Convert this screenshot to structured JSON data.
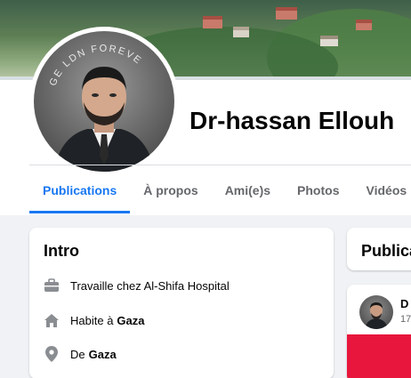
{
  "profile": {
    "name": "Dr-hassan Ellouh",
    "avatar_arc_text": "GE LDN FOREVE"
  },
  "tabs": [
    {
      "label": "Publications",
      "active": true
    },
    {
      "label": "À propos",
      "active": false
    },
    {
      "label": "Ami(e)s",
      "active": false
    },
    {
      "label": "Photos",
      "active": false
    },
    {
      "label": "Vidéos",
      "active": false
    }
  ],
  "intro": {
    "title": "Intro",
    "work": {
      "prefix": "Travaille chez Al-Shifa Hospital",
      "icon": "briefcase-icon"
    },
    "lives": {
      "prefix": "Habite à",
      "place": "Gaza",
      "icon": "home-icon"
    },
    "from": {
      "prefix": "De",
      "place": "Gaza",
      "icon": "location-pin-icon"
    }
  },
  "feed": {
    "publications_heading": "Publica",
    "post": {
      "author": "D",
      "time": "17"
    }
  },
  "colors": {
    "accent": "#1877f2",
    "text": "#050505",
    "muted": "#65676b",
    "post_banner": "#e8163c"
  }
}
